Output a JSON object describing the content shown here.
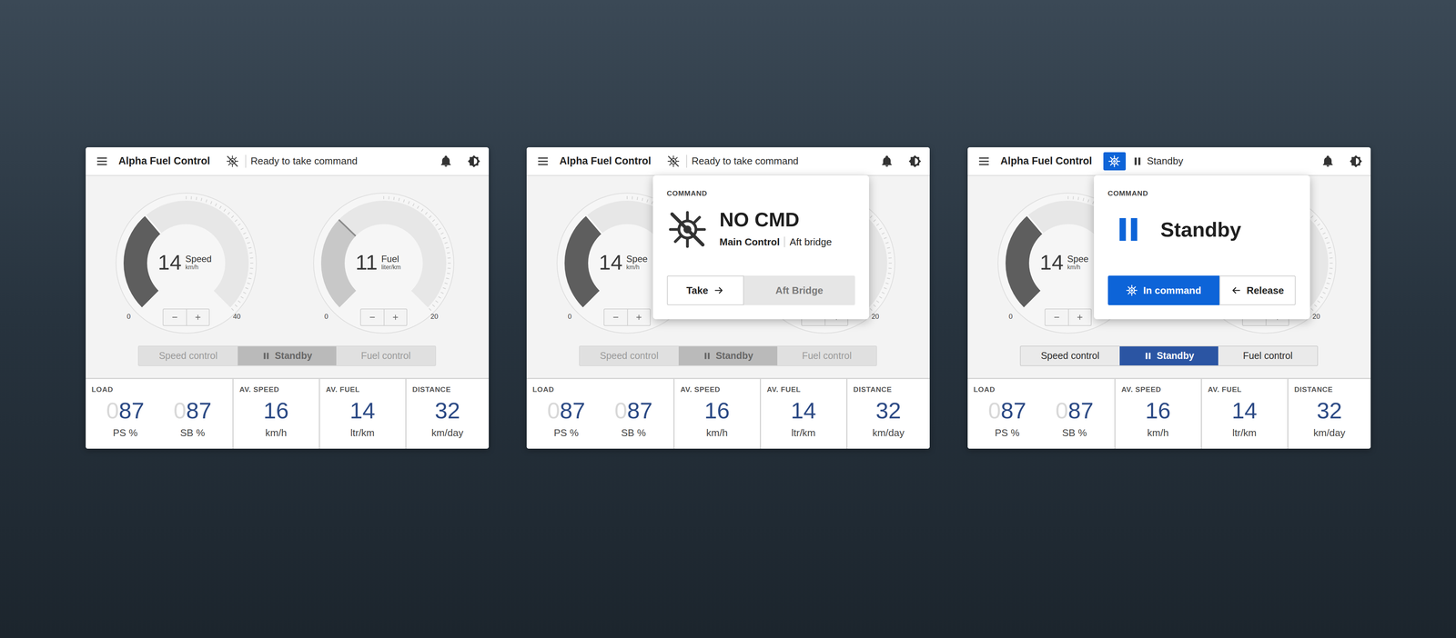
{
  "panels": [
    {
      "header": {
        "title": "Alpha Fuel Control",
        "in_command": false,
        "status_kind": "ready",
        "status": "Ready to take command"
      },
      "gauges": [
        {
          "value": "14",
          "label": "Speed",
          "unit": "km/h",
          "min": "0",
          "max": "40",
          "level": 0.35,
          "active": true
        },
        {
          "value": "11",
          "label": "Fuel",
          "unit": "liter/km",
          "min": "0",
          "max": "20",
          "level": 0.33,
          "active": false
        }
      ],
      "modes": {
        "disabled": true,
        "items": [
          {
            "label": "Speed control",
            "selected": false,
            "kind": "mode"
          },
          {
            "label": "Standby",
            "selected": true,
            "kind": "standby"
          },
          {
            "label": "Fuel control",
            "selected": false,
            "kind": "mode"
          }
        ]
      },
      "stats": [
        {
          "label": "LOAD",
          "values": [
            {
              "pad": "0",
              "value": "87",
              "unit": "PS %"
            },
            {
              "pad": "0",
              "value": "87",
              "unit": "SB %"
            }
          ]
        },
        {
          "label": "AV. SPEED",
          "values": [
            {
              "pad": null,
              "value": "16",
              "unit": "km/h"
            }
          ]
        },
        {
          "label": "AV. FUEL",
          "values": [
            {
              "pad": null,
              "value": "14",
              "unit": "ltr/km"
            }
          ]
        },
        {
          "label": "DISTANCE",
          "values": [
            {
              "pad": null,
              "value": "32",
              "unit": "km/day"
            }
          ]
        }
      ],
      "popover": null
    },
    {
      "header": {
        "title": "Alpha Fuel Control",
        "in_command": false,
        "status_kind": "ready",
        "status": "Ready to take command"
      },
      "gauges": [
        {
          "value": "14",
          "label": "Spee",
          "unit": "km/h",
          "min": "0",
          "max": null,
          "level": 0.35,
          "active": true
        },
        {
          "value": null,
          "label": null,
          "unit": null,
          "min": null,
          "max": "20",
          "level": null,
          "active": false
        }
      ],
      "modes": {
        "disabled": true,
        "items": [
          {
            "label": "Speed control",
            "selected": false,
            "kind": "mode"
          },
          {
            "label": "Standby",
            "selected": true,
            "kind": "standby"
          },
          {
            "label": "Fuel control",
            "selected": false,
            "kind": "mode"
          }
        ]
      },
      "stats": [
        {
          "label": "LOAD",
          "values": [
            {
              "pad": "0",
              "value": "87",
              "unit": "PS %"
            },
            {
              "pad": "0",
              "value": "87",
              "unit": "SB %"
            }
          ]
        },
        {
          "label": "AV. SPEED",
          "values": [
            {
              "pad": null,
              "value": "16",
              "unit": "km/h"
            }
          ]
        },
        {
          "label": "AV. FUEL",
          "values": [
            {
              "pad": null,
              "value": "14",
              "unit": "ltr/km"
            }
          ]
        },
        {
          "label": "DISTANCE",
          "values": [
            {
              "pad": null,
              "value": "32",
              "unit": "km/day"
            }
          ]
        }
      ],
      "popover": {
        "heading": "COMMAND",
        "kind": "none",
        "title": "NO CMD",
        "source": "Main Control",
        "location": "Aft bridge",
        "buttons": [
          {
            "label": "Take",
            "kind": "take",
            "selected": false,
            "disabled": false
          },
          {
            "label": "Aft Bridge",
            "kind": "location",
            "selected": false,
            "disabled": true
          }
        ]
      }
    },
    {
      "header": {
        "title": "Alpha Fuel Control",
        "in_command": true,
        "status_kind": "standby",
        "status": "Standby"
      },
      "gauges": [
        {
          "value": "14",
          "label": "Spee",
          "unit": "km/h",
          "min": "0",
          "max": null,
          "level": 0.35,
          "active": true
        },
        {
          "value": null,
          "label": null,
          "unit": null,
          "min": null,
          "max": "20",
          "level": null,
          "active": false
        }
      ],
      "modes": {
        "disabled": false,
        "items": [
          {
            "label": "Speed control",
            "selected": false,
            "kind": "mode"
          },
          {
            "label": "Standby",
            "selected": true,
            "kind": "standby"
          },
          {
            "label": "Fuel control",
            "selected": false,
            "kind": "mode"
          }
        ]
      },
      "stats": [
        {
          "label": "LOAD",
          "values": [
            {
              "pad": "0",
              "value": "87",
              "unit": "PS %"
            },
            {
              "pad": "0",
              "value": "87",
              "unit": "SB %"
            }
          ]
        },
        {
          "label": "AV. SPEED",
          "values": [
            {
              "pad": null,
              "value": "16",
              "unit": "km/h"
            }
          ]
        },
        {
          "label": "AV. FUEL",
          "values": [
            {
              "pad": null,
              "value": "14",
              "unit": "ltr/km"
            }
          ]
        },
        {
          "label": "DISTANCE",
          "values": [
            {
              "pad": null,
              "value": "32",
              "unit": "km/day"
            }
          ]
        }
      ],
      "popover": {
        "heading": "COMMAND",
        "kind": "standby",
        "title": "Standby",
        "source": null,
        "location": null,
        "buttons": [
          {
            "label": "In command",
            "kind": "command",
            "selected": true,
            "disabled": false
          },
          {
            "label": "Release",
            "kind": "release",
            "selected": false,
            "disabled": false
          }
        ]
      }
    }
  ]
}
